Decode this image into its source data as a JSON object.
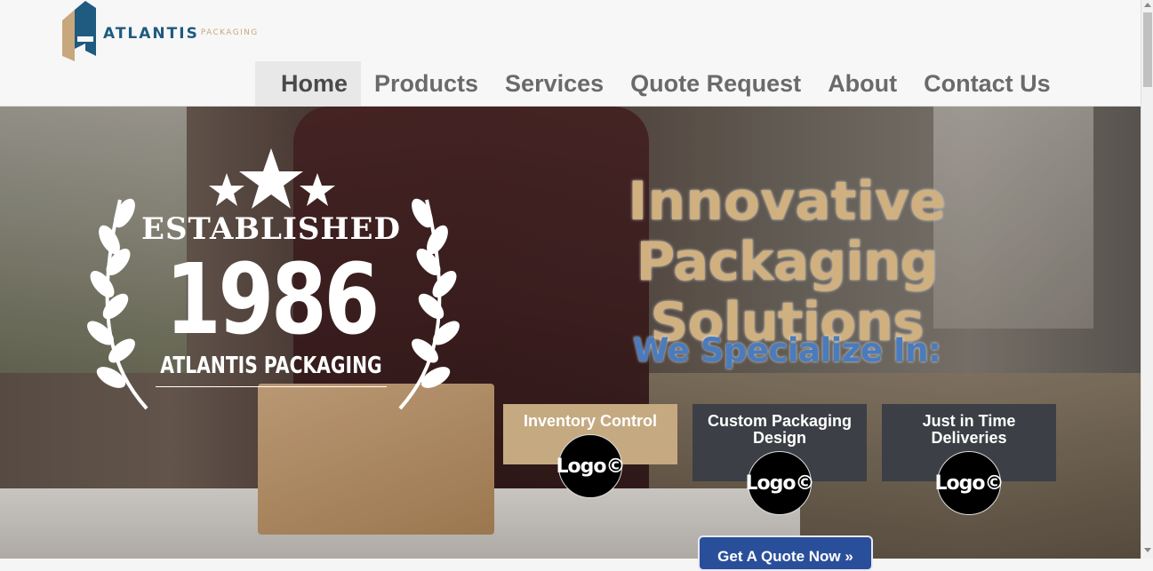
{
  "brand": {
    "name": "ATLANTIS",
    "tagline": "PACKAGING"
  },
  "nav": {
    "items": [
      {
        "label": "Home",
        "active": true
      },
      {
        "label": "Products",
        "active": false
      },
      {
        "label": "Services",
        "active": false
      },
      {
        "label": "Quote Request",
        "active": false
      },
      {
        "label": "About",
        "active": false
      },
      {
        "label": "Contact Us",
        "active": false
      }
    ]
  },
  "hero": {
    "badge": {
      "word": "ESTABLISHED",
      "year": "1986",
      "company": "ATLANTIS PACKAGING"
    },
    "headline_line1": "Innovative",
    "headline_line2": "Packaging Solutions",
    "subheading": "We Specialize In:",
    "services": [
      {
        "title": "Inventory Control",
        "logo": "Logo©",
        "color": "#c5a980"
      },
      {
        "title": "Custom Packaging Design",
        "logo": "Logo©",
        "color": "#3c3f45"
      },
      {
        "title": "Just in Time Deliveries",
        "logo": "Logo©",
        "color": "#3c3f45"
      }
    ],
    "cta": "Get A Quote Now »"
  },
  "colors": {
    "brand_blue": "#1f5a80",
    "brand_gold": "#c9a77c",
    "headline_gold": "#d0b07f",
    "subheading_blue": "#4a7bbd",
    "cta_blue": "#2a4f9a"
  }
}
